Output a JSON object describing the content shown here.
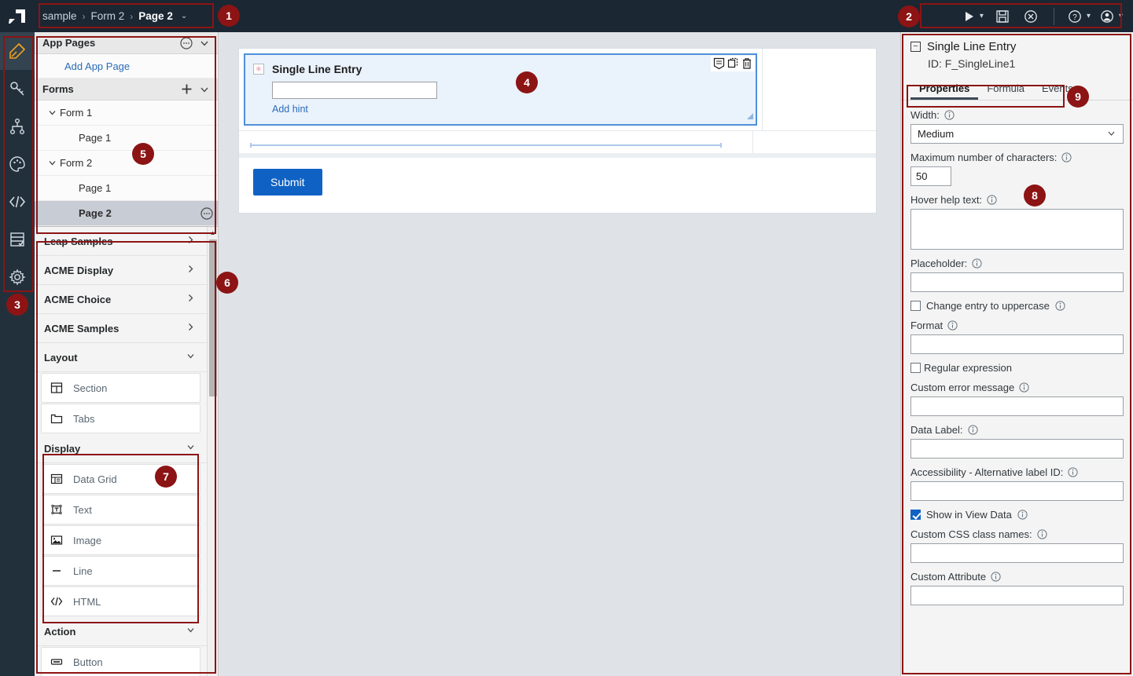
{
  "app": {
    "logo": "leap-logo-icon"
  },
  "breadcrumb": {
    "items": [
      "sample",
      "Form 2",
      "Page 2"
    ],
    "separator": "›",
    "caret": "⌄"
  },
  "toolbar": {
    "preview_label": "preview-play-icon",
    "save_label": "save-disk-icon",
    "close_label": "close-circle-icon",
    "help_label": "help-circle-icon",
    "account_label": "user-account-icon"
  },
  "rail": {
    "items": [
      {
        "name": "design-brush",
        "active": true
      },
      {
        "name": "key",
        "active": false
      },
      {
        "name": "workflow",
        "active": false
      },
      {
        "name": "theme-palette",
        "active": false
      },
      {
        "name": "code",
        "active": false
      },
      {
        "name": "data-check",
        "active": false
      },
      {
        "name": "settings-gear",
        "active": false
      }
    ]
  },
  "left_panel": {
    "app_pages": {
      "title": "App Pages",
      "menu_icon": "overflow-menu-icon",
      "chevron": "⌄",
      "add_link": "Add App Page"
    },
    "forms": {
      "title": "Forms",
      "add_icon": "+",
      "chevron": "⌄",
      "tree": [
        {
          "label": "Form 1",
          "type": "form",
          "expanded": true,
          "selected": false
        },
        {
          "label": "Page 1",
          "type": "page",
          "selected": false
        },
        {
          "label": "Form 2",
          "type": "form",
          "expanded": true,
          "selected": false
        },
        {
          "label": "Page 1",
          "type": "page",
          "selected": false
        },
        {
          "label": "Page 2",
          "type": "page",
          "selected": true,
          "menu_icon": "overflow-menu-icon"
        }
      ]
    },
    "palette": {
      "groups": [
        {
          "label": "Leap Samples",
          "expanded": false,
          "chevron": "›",
          "items": []
        },
        {
          "label": "ACME Display",
          "expanded": false,
          "chevron": "›",
          "items": []
        },
        {
          "label": "ACME Choice",
          "expanded": false,
          "chevron": "›",
          "items": []
        },
        {
          "label": "ACME Samples",
          "expanded": false,
          "chevron": "›",
          "items": []
        },
        {
          "label": "Layout",
          "expanded": true,
          "chevron": "⌄",
          "items": [
            {
              "label": "Section",
              "icon": "section-layout-icon"
            },
            {
              "label": "Tabs",
              "icon": "tabs-folder-icon"
            }
          ]
        },
        {
          "label": "Display",
          "expanded": true,
          "chevron": "⌄",
          "items": [
            {
              "label": "Data Grid",
              "icon": "data-grid-icon"
            },
            {
              "label": "Text",
              "icon": "text-box-icon"
            },
            {
              "label": "Image",
              "icon": "image-icon"
            },
            {
              "label": "Line",
              "icon": "line-icon"
            },
            {
              "label": "HTML",
              "icon": "html-code-icon"
            }
          ]
        },
        {
          "label": "Action",
          "expanded": true,
          "chevron": "⌄",
          "items": [
            {
              "label": "Button",
              "icon": "button-icon"
            }
          ]
        }
      ]
    }
  },
  "canvas": {
    "widget": {
      "label": "Single Line Entry",
      "required_marker": "∗",
      "input_value": "",
      "hint_link": "Add hint",
      "tools": [
        "notes-icon",
        "duplicate-icon",
        "delete-trash-icon"
      ],
      "resize_handle": "resize-handle-icon"
    },
    "submit_label": "Submit"
  },
  "right_panel": {
    "title": "Single Line Entry",
    "collapse_glyph": "−",
    "id_label": "ID:",
    "id_value": "F_SingleLine1",
    "tabs": [
      {
        "label": "Properties",
        "active": true
      },
      {
        "label": "Formula",
        "active": false
      },
      {
        "label": "Events",
        "active": false
      }
    ],
    "fields": {
      "width_label": "Width:",
      "width_value": "Medium",
      "max_chars_label": "Maximum number of characters:",
      "max_chars_value": "50",
      "hover_help_label": "Hover help text:",
      "hover_help_value": "",
      "placeholder_label": "Placeholder:",
      "placeholder_value": "",
      "uppercase_label": "Change entry to uppercase",
      "uppercase_checked": false,
      "format_label": "Format",
      "format_value": "",
      "regex_label": "Regular expression",
      "regex_checked": false,
      "custom_error_label": "Custom error message",
      "custom_error_value": "",
      "data_label_label": "Data Label:",
      "data_label_value": "",
      "alt_label_label": "Accessibility - Alternative label ID:",
      "alt_label_value": "",
      "show_view_data_label": "Show in View Data",
      "show_view_data_checked": true,
      "css_class_label": "Custom CSS class names:",
      "css_class_value": "",
      "custom_attr_label": "Custom Attribute",
      "custom_attr_value": ""
    }
  },
  "annotations": {
    "markers": [
      "1",
      "2",
      "3",
      "4",
      "5",
      "6",
      "7",
      "8",
      "9"
    ],
    "accent": "#8c1414"
  }
}
